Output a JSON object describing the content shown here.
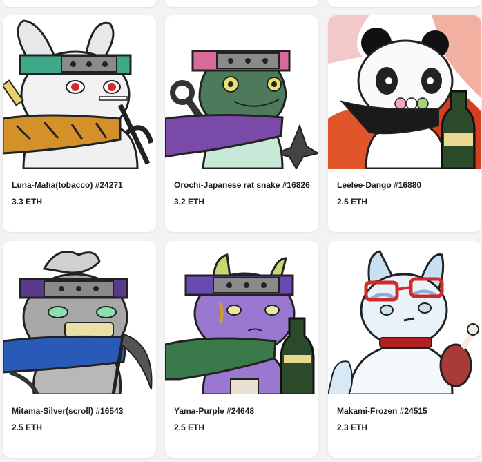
{
  "items": [
    {
      "name": "Luna-Mafia(tobacco) #24271",
      "price": "3.3 ETH",
      "icon": "rabbit-ninja-art"
    },
    {
      "name": "Orochi-Japanese rat snake #16826",
      "price": "3.2 ETH",
      "icon": "snake-ninja-art"
    },
    {
      "name": "Leelee-Dango #16880",
      "price": "2.5 ETH",
      "icon": "panda-ninja-art"
    },
    {
      "name": "Mitama-Silver(scroll) #16543",
      "price": "2.5 ETH",
      "icon": "ghost-ninja-art"
    },
    {
      "name": "Yama-Purple #24648",
      "price": "2.5 ETH",
      "icon": "oni-ninja-art"
    },
    {
      "name": "Makami-Frozen #24515",
      "price": "2.3 ETH",
      "icon": "wolf-ninja-art"
    }
  ],
  "colors": {
    "background": "#f3f3f3",
    "card": "#ffffff",
    "text": "#1b1b1b"
  }
}
